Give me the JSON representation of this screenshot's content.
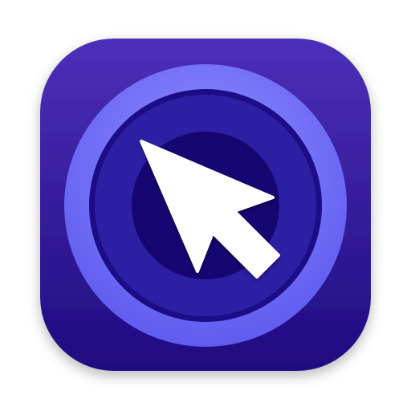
{
  "icon": {
    "name": "cursor-app-icon",
    "glyph": "arrow-pointer-icon",
    "colors": {
      "background_top": "#4d2fb8",
      "background_bottom": "#1f0b80",
      "outer_ring": "#5f5cf0",
      "outer_ring_highlight": "#8e8cff",
      "middle_ring": "#1c0c86",
      "inner_ring": "#2d1fa3",
      "core": "#150672",
      "cursor": "#ffffff"
    }
  }
}
